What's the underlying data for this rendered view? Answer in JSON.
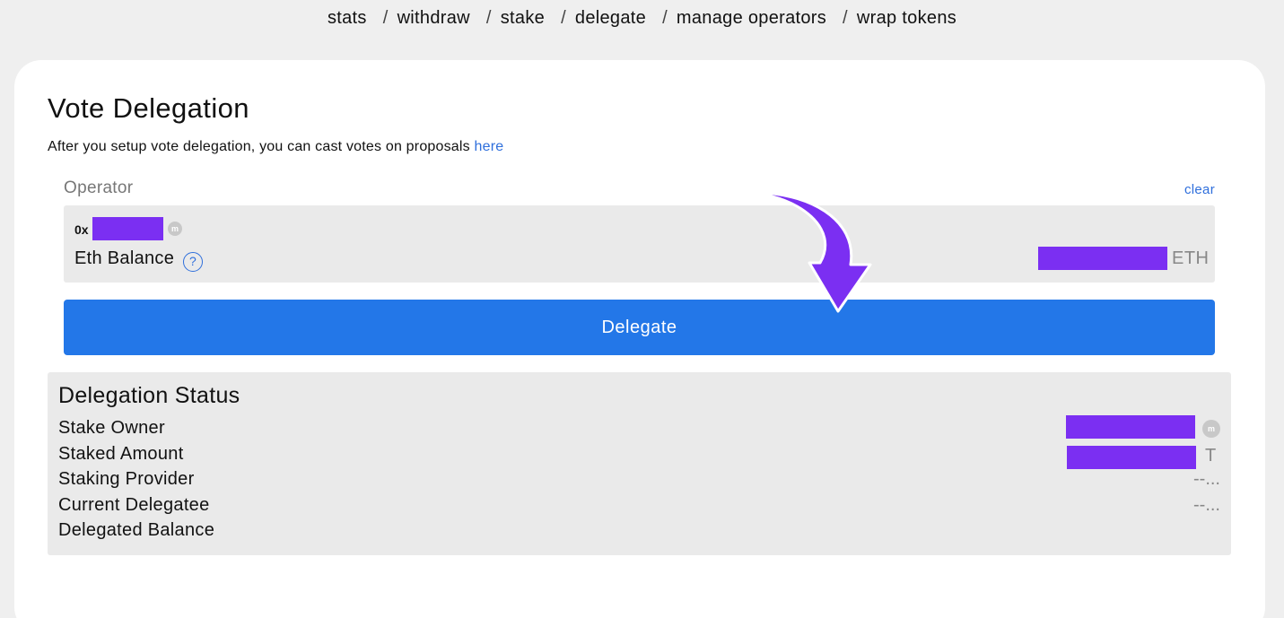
{
  "nav": {
    "items": [
      "stats",
      "withdraw",
      "stake",
      "delegate",
      "manage operators",
      "wrap tokens"
    ],
    "separator": "/"
  },
  "card": {
    "title": "Vote Delegation",
    "subtitle": "After you setup vote delegation, you can cast votes on proposals",
    "subtitle_link": "here"
  },
  "operator": {
    "label": "Operator",
    "clear_label": "clear",
    "address_prefix": "0x",
    "balance_label": "Eth Balance",
    "help_glyph": "?",
    "balance_unit": "ETH"
  },
  "delegate_button": {
    "label": "Delegate"
  },
  "status": {
    "title": "Delegation Status",
    "rows": {
      "stake_owner": "Stake Owner",
      "staked_amount": "Staked Amount",
      "staking_provider": "Staking Provider",
      "current_delegatee": "Current Delegatee",
      "delegated_balance": "Delegated Balance"
    },
    "staked_amount_unit": "T",
    "staking_provider_value": "--...",
    "current_delegatee_value": "--..."
  },
  "colors": {
    "accent_blue": "#2377e8",
    "link_blue": "#2f6fdc",
    "redaction_purple": "#7b2ff2",
    "panel_gray": "#eaeaea",
    "page_bg": "#efefef"
  },
  "icons": {
    "etherscan": "etherscan-icon",
    "help": "help-icon",
    "annotation_arrow": "arrow-icon"
  }
}
